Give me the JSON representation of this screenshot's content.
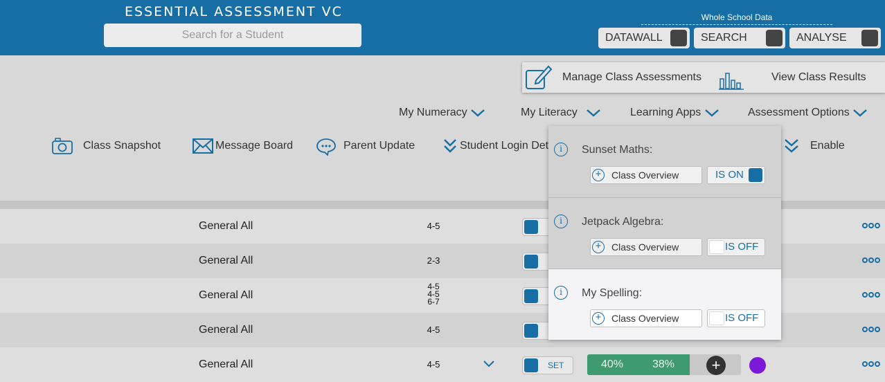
{
  "header": {
    "app_title": "ESSENTIAL ASSESSMENT VC",
    "search_placeholder": "Search for a Student",
    "whole_school_label": "Whole School Data",
    "buttons": [
      "DATAWALL",
      "SEARCH",
      "ANALYSE"
    ]
  },
  "manage_bar": {
    "manage_label": "Manage Class Assessments",
    "results_label": "View Class Results"
  },
  "menu": {
    "numeracy": "My Numeracy",
    "literacy": "My Literacy",
    "apps": "Learning Apps",
    "options": "Assessment Options"
  },
  "toolbar": {
    "snapshot": "Class Snapshot",
    "message": "Message Board",
    "parent": "Parent Update",
    "login": "Student Login Deta",
    "enable": "Enable"
  },
  "rows": [
    {
      "name": "General All",
      "level": "4-5"
    },
    {
      "name": "General All",
      "level": "2-3"
    },
    {
      "name": "General All",
      "levels": [
        "4-5",
        "4-5",
        "6-7"
      ]
    },
    {
      "name": "General All",
      "level": "4-5"
    },
    {
      "name": "General All",
      "level": "4-5",
      "toggle_label": "SET",
      "pct1": "40%",
      "pct2": "38%"
    }
  ],
  "popover": {
    "apps": [
      {
        "name": "Sunset Maths:",
        "overview": "Class Overview",
        "status": "IS ON"
      },
      {
        "name": "Jetpack Algebra:",
        "overview": "Class Overview",
        "status": "IS OFF"
      },
      {
        "name": "My Spelling:",
        "overview": "Class Overview",
        "status": "IS OFF"
      }
    ]
  },
  "colors": {
    "brand_blue": "#166ea5",
    "progress_green": "#3e9b6e",
    "purple": "#7a1ad8"
  }
}
